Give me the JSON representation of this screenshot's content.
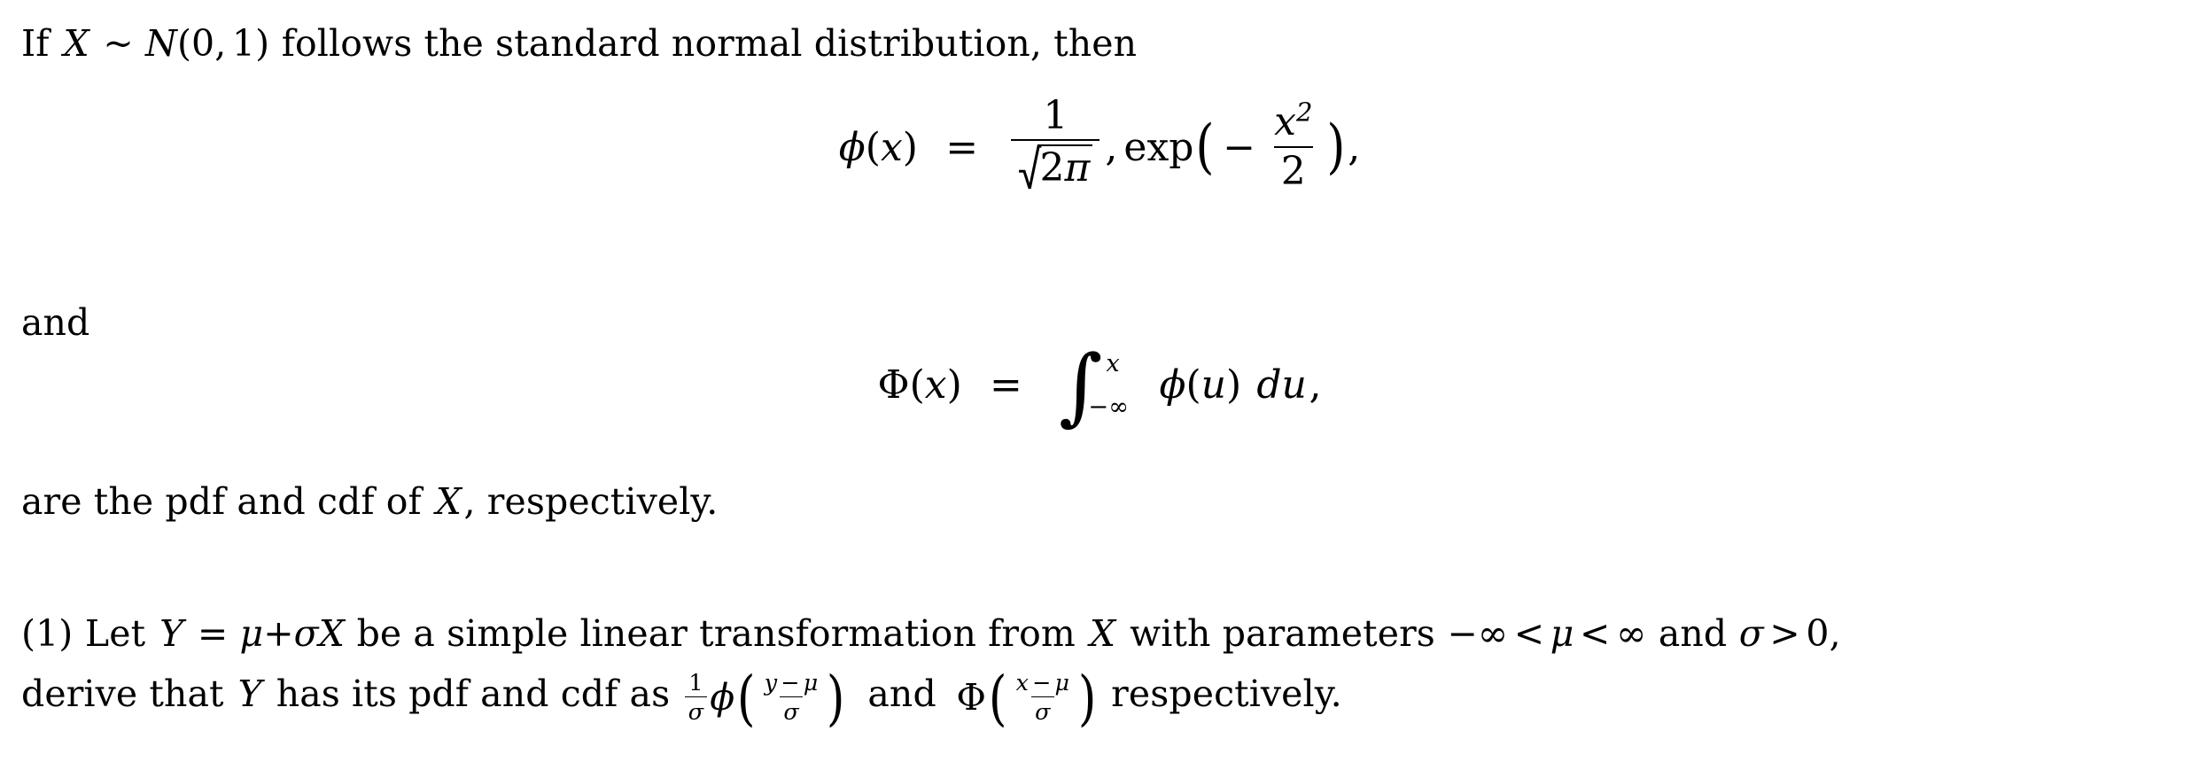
{
  "document": {
    "background_color": "#ffffff",
    "text_color": "#000000",
    "intro": {
      "prefix": "If",
      "var_x": "X",
      "relation": "~",
      "dist_name": "N",
      "dist_open": "(",
      "dist_mean": "0",
      "dist_comma": ",",
      "dist_var": "1",
      "dist_close": ")",
      "suffix": "follows the standard normal distribution, then"
    },
    "equation_pdf": {
      "label": "phi-pdf-equation",
      "lhs_fn": "ϕ",
      "lhs_open": "(",
      "lhs_arg": "x",
      "lhs_close": ")",
      "equals": "=",
      "frac_num": "1",
      "sqrt_radicand_num": "2",
      "sqrt_radicand_sym": "π",
      "comma_after_frac": ",",
      "exp_name": "exp",
      "exp_open": "(",
      "minus": "−",
      "exponent_num_base": "x",
      "exponent_num_power": "2",
      "exponent_den": "2",
      "exp_close": ")",
      "trailing_comma": ","
    },
    "connector": "and",
    "equation_cdf": {
      "label": "Phi-cdf-equation",
      "lhs_fn": "Φ",
      "lhs_open": "(",
      "lhs_arg": "x",
      "lhs_close": ")",
      "equals": "=",
      "integral_sign": "∫",
      "upper_limit": "x",
      "lower_limit": "−∞",
      "integrand_fn": "ϕ",
      "integrand_open": "(",
      "integrand_arg": "u",
      "integrand_close": ")",
      "differential": "du",
      "trailing_comma": ","
    },
    "closing": {
      "text_a": "are the pdf and cdf of",
      "var_x": "X",
      "text_b": ", respectively."
    },
    "part_one": {
      "number": "(1)",
      "line1_a": "Let",
      "var_y": "Y",
      "equals": "=",
      "mu": "μ",
      "plus": "+",
      "sigma": "σ",
      "var_x": "X",
      "line1_b": "be a simple linear transformation from",
      "var_x2": "X",
      "line1_c": "with parameters",
      "neg_inf": "−∞",
      "lt1": "<",
      "mu2": "μ",
      "lt2": "<",
      "pos_inf": "∞",
      "and_word": "and",
      "sigma2": "σ",
      "gt": ">",
      "zero": "0",
      "line1_end_comma": ",",
      "line2_a": "derive that",
      "var_y2": "Y",
      "line2_b": "has its pdf and cdf as",
      "pdf_frac_num": "1",
      "pdf_frac_den": "σ",
      "pdf_fn": "ϕ",
      "pdf_open": "(",
      "pdf_inner_num_y": "y",
      "pdf_inner_num_minus": "−",
      "pdf_inner_num_mu": "μ",
      "pdf_inner_den": "σ",
      "pdf_close": ")",
      "and_word2": "and",
      "cdf_fn": "Φ",
      "cdf_open": "(",
      "cdf_inner_num_x": "x",
      "cdf_inner_num_minus": "−",
      "cdf_inner_num_mu": "μ",
      "cdf_inner_den": "σ",
      "cdf_close": ")",
      "line2_end": "respectively."
    }
  }
}
